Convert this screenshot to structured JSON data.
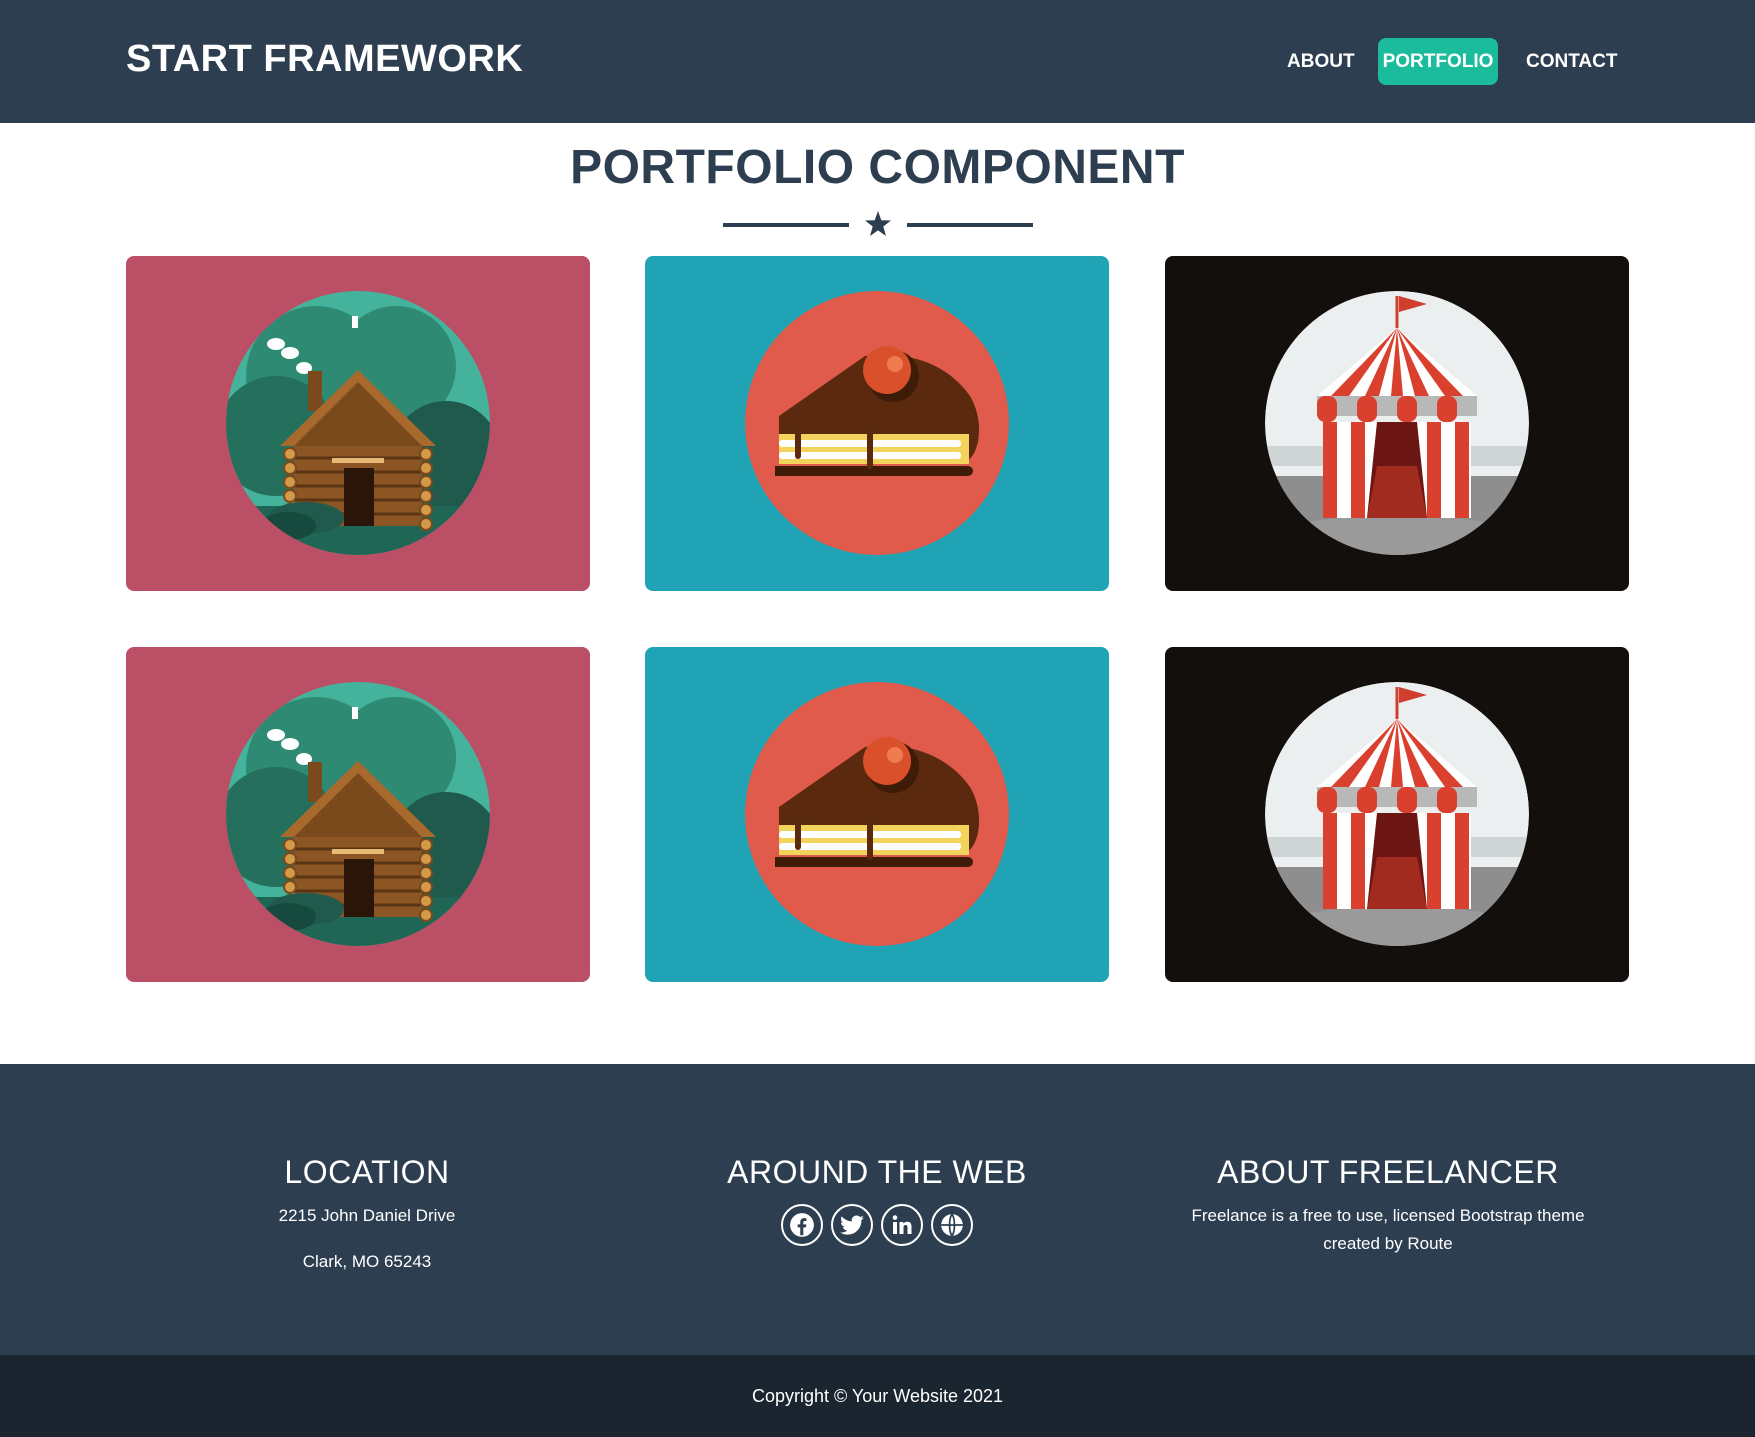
{
  "navbar": {
    "brand": "START FRAMEWORK",
    "items": [
      {
        "label": "ABOUT",
        "active": false
      },
      {
        "label": "PORTFOLIO",
        "active": true
      },
      {
        "label": "CONTACT",
        "active": false
      }
    ],
    "active_color": "#1abc9c"
  },
  "main": {
    "title": "PORTFOLIO COMPONENT",
    "divider_icon": "star-icon",
    "portfolio": [
      {
        "image": "log-cabin-illustration",
        "bg": "#bb4f66"
      },
      {
        "image": "cake-slice-illustration",
        "bg": "#21a3b6"
      },
      {
        "image": "circus-tent-illustration",
        "bg": "#130f0d"
      },
      {
        "image": "log-cabin-illustration",
        "bg": "#bb4f66"
      },
      {
        "image": "cake-slice-illustration",
        "bg": "#21a3b6"
      },
      {
        "image": "circus-tent-illustration",
        "bg": "#130f0d"
      }
    ]
  },
  "footer": {
    "location": {
      "heading": "LOCATION",
      "line1": "2215 John Daniel Drive",
      "line2": "Clark, MO 65243"
    },
    "around_web": {
      "heading": "AROUND THE WEB",
      "icons": [
        "facebook-icon",
        "twitter-icon",
        "linkedin-icon",
        "dribbble-icon"
      ]
    },
    "about": {
      "heading": "ABOUT FREELANCER",
      "text": "Freelance is a free to use, licensed Bootstrap theme created by Route"
    },
    "copyright": "Copyright © Your Website 2021"
  },
  "colors": {
    "primary": "#2c3e50",
    "accent": "#1abc9c",
    "dark": "#1a252f"
  }
}
